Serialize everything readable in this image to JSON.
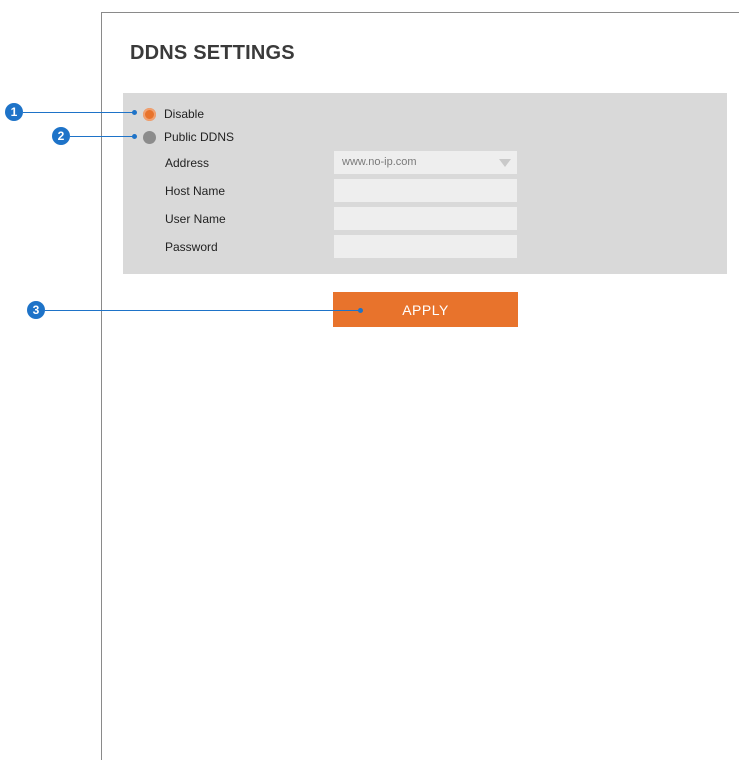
{
  "page": {
    "title": "DDNS SETTINGS"
  },
  "ddns_mode": {
    "options": [
      {
        "label": "Disable",
        "selected": true
      },
      {
        "label": "Public DDNS",
        "selected": false
      }
    ]
  },
  "fields": {
    "address": {
      "label": "Address",
      "value": "www.no-ip.com"
    },
    "host_name": {
      "label": "Host Name",
      "value": ""
    },
    "user_name": {
      "label": "User Name",
      "value": ""
    },
    "password": {
      "label": "Password",
      "value": ""
    }
  },
  "actions": {
    "apply_label": "APPLY"
  },
  "callouts": [
    "1",
    "2",
    "3"
  ],
  "colors": {
    "accent": "#e8732c",
    "callout": "#1e73c8",
    "panel": "#d9d9d9"
  },
  "icons": {
    "dropdown": "chevron-down-icon"
  }
}
